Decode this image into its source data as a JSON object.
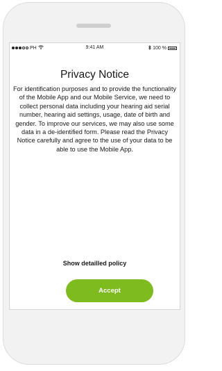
{
  "status_bar": {
    "carrier": "PH",
    "time": "9:41 AM",
    "battery": "100 %"
  },
  "privacy": {
    "title": "Privacy Notice",
    "body": "For identification purposes and to provide the functionality of the Mobile App and our Mobile Service, we need to collect personal data including your hearing aid serial number, hearing aid settings, usage, date of birth and gender. To improve our services, we may also use some data in a de-identified form. Please read the Privacy Notice carefully and agree to the use of your data to be able to use the Mobile App.",
    "policy_link": "Show detailled policy",
    "accept_label": "Accept"
  },
  "colors": {
    "accent": "#7dbb1f"
  },
  "icons": {
    "signal": "signal-dots-icon",
    "wifi": "wifi-icon",
    "bluetooth": "bluetooth-icon",
    "battery": "battery-icon"
  }
}
